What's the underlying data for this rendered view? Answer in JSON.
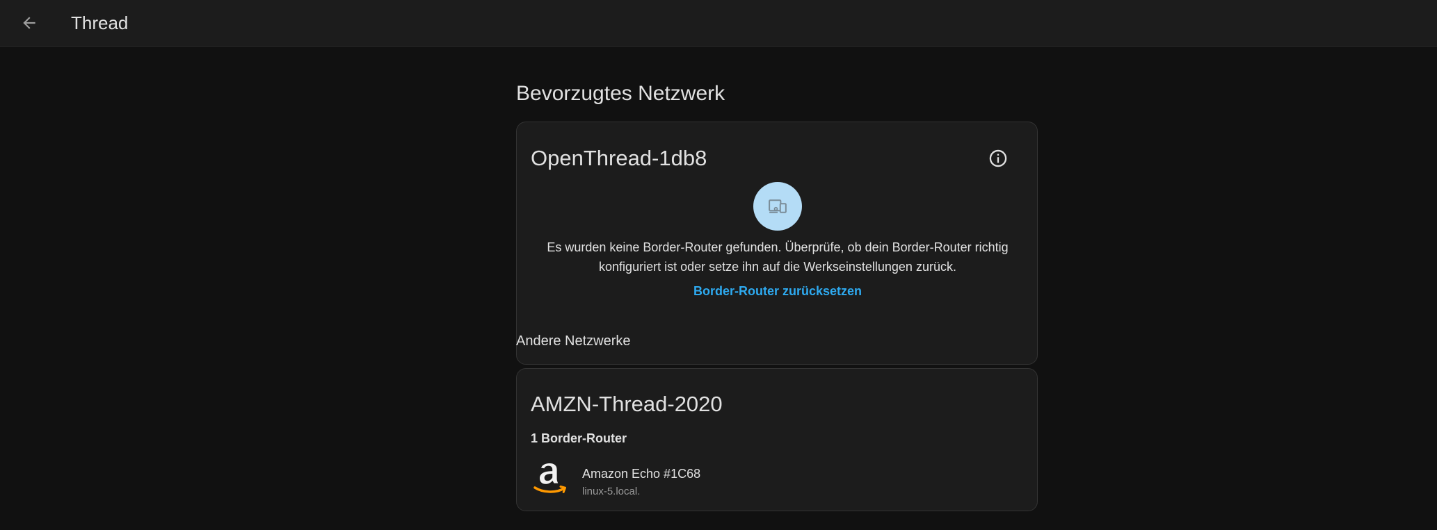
{
  "header": {
    "title": "Thread",
    "back_icon": "arrow-left-icon"
  },
  "preferred": {
    "heading": "Bevorzugtes Netzwerk",
    "network_name": "OpenThread-1db8",
    "info_icon": "info-circle-icon",
    "avatar_icon": "router-devices-icon",
    "avatar_color": "#b4dcf6",
    "message": "Es wurden keine Border-Router gefunden. Überprüfe, ob dein Border-Router richtig konfiguriert ist oder setze ihn auf die Werkseinstellungen zurück.",
    "reset_link": "Border-Router zurücksetzen",
    "link_color": "#2eaaf0"
  },
  "other": {
    "heading": "Andere Netzwerke",
    "networks": [
      {
        "name": "AMZN-Thread-2020",
        "router_count": "1 Border-Router",
        "routers": [
          {
            "name": "Amazon Echo #1C68",
            "host": "linux-5.local.",
            "icon": "amazon-logo-icon"
          }
        ]
      }
    ]
  }
}
